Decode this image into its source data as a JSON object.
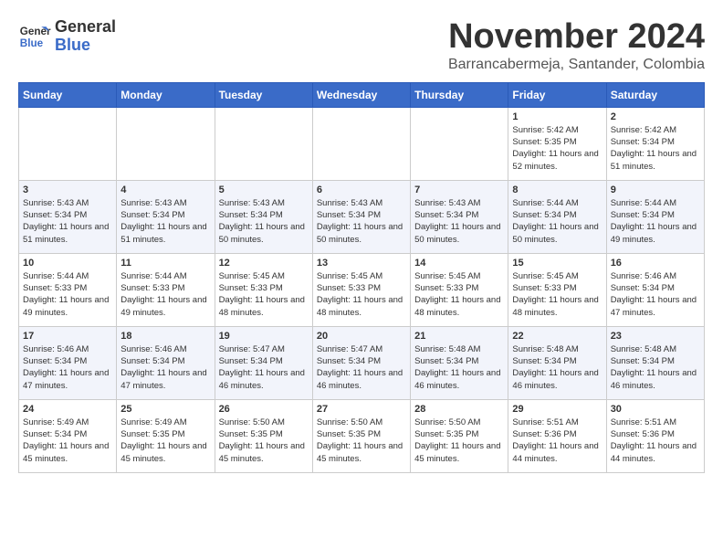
{
  "logo": {
    "line1": "General",
    "line2": "Blue"
  },
  "title": "November 2024",
  "subtitle": "Barrancabermeja, Santander, Colombia",
  "days_of_week": [
    "Sunday",
    "Monday",
    "Tuesday",
    "Wednesday",
    "Thursday",
    "Friday",
    "Saturday"
  ],
  "weeks": [
    [
      {
        "day": "",
        "info": ""
      },
      {
        "day": "",
        "info": ""
      },
      {
        "day": "",
        "info": ""
      },
      {
        "day": "",
        "info": ""
      },
      {
        "day": "",
        "info": ""
      },
      {
        "day": "1",
        "info": "Sunrise: 5:42 AM\nSunset: 5:35 PM\nDaylight: 11 hours and 52 minutes."
      },
      {
        "day": "2",
        "info": "Sunrise: 5:42 AM\nSunset: 5:34 PM\nDaylight: 11 hours and 51 minutes."
      }
    ],
    [
      {
        "day": "3",
        "info": "Sunrise: 5:43 AM\nSunset: 5:34 PM\nDaylight: 11 hours and 51 minutes."
      },
      {
        "day": "4",
        "info": "Sunrise: 5:43 AM\nSunset: 5:34 PM\nDaylight: 11 hours and 51 minutes."
      },
      {
        "day": "5",
        "info": "Sunrise: 5:43 AM\nSunset: 5:34 PM\nDaylight: 11 hours and 50 minutes."
      },
      {
        "day": "6",
        "info": "Sunrise: 5:43 AM\nSunset: 5:34 PM\nDaylight: 11 hours and 50 minutes."
      },
      {
        "day": "7",
        "info": "Sunrise: 5:43 AM\nSunset: 5:34 PM\nDaylight: 11 hours and 50 minutes."
      },
      {
        "day": "8",
        "info": "Sunrise: 5:44 AM\nSunset: 5:34 PM\nDaylight: 11 hours and 50 minutes."
      },
      {
        "day": "9",
        "info": "Sunrise: 5:44 AM\nSunset: 5:34 PM\nDaylight: 11 hours and 49 minutes."
      }
    ],
    [
      {
        "day": "10",
        "info": "Sunrise: 5:44 AM\nSunset: 5:33 PM\nDaylight: 11 hours and 49 minutes."
      },
      {
        "day": "11",
        "info": "Sunrise: 5:44 AM\nSunset: 5:33 PM\nDaylight: 11 hours and 49 minutes."
      },
      {
        "day": "12",
        "info": "Sunrise: 5:45 AM\nSunset: 5:33 PM\nDaylight: 11 hours and 48 minutes."
      },
      {
        "day": "13",
        "info": "Sunrise: 5:45 AM\nSunset: 5:33 PM\nDaylight: 11 hours and 48 minutes."
      },
      {
        "day": "14",
        "info": "Sunrise: 5:45 AM\nSunset: 5:33 PM\nDaylight: 11 hours and 48 minutes."
      },
      {
        "day": "15",
        "info": "Sunrise: 5:45 AM\nSunset: 5:33 PM\nDaylight: 11 hours and 48 minutes."
      },
      {
        "day": "16",
        "info": "Sunrise: 5:46 AM\nSunset: 5:34 PM\nDaylight: 11 hours and 47 minutes."
      }
    ],
    [
      {
        "day": "17",
        "info": "Sunrise: 5:46 AM\nSunset: 5:34 PM\nDaylight: 11 hours and 47 minutes."
      },
      {
        "day": "18",
        "info": "Sunrise: 5:46 AM\nSunset: 5:34 PM\nDaylight: 11 hours and 47 minutes."
      },
      {
        "day": "19",
        "info": "Sunrise: 5:47 AM\nSunset: 5:34 PM\nDaylight: 11 hours and 46 minutes."
      },
      {
        "day": "20",
        "info": "Sunrise: 5:47 AM\nSunset: 5:34 PM\nDaylight: 11 hours and 46 minutes."
      },
      {
        "day": "21",
        "info": "Sunrise: 5:48 AM\nSunset: 5:34 PM\nDaylight: 11 hours and 46 minutes."
      },
      {
        "day": "22",
        "info": "Sunrise: 5:48 AM\nSunset: 5:34 PM\nDaylight: 11 hours and 46 minutes."
      },
      {
        "day": "23",
        "info": "Sunrise: 5:48 AM\nSunset: 5:34 PM\nDaylight: 11 hours and 46 minutes."
      }
    ],
    [
      {
        "day": "24",
        "info": "Sunrise: 5:49 AM\nSunset: 5:34 PM\nDaylight: 11 hours and 45 minutes."
      },
      {
        "day": "25",
        "info": "Sunrise: 5:49 AM\nSunset: 5:35 PM\nDaylight: 11 hours and 45 minutes."
      },
      {
        "day": "26",
        "info": "Sunrise: 5:50 AM\nSunset: 5:35 PM\nDaylight: 11 hours and 45 minutes."
      },
      {
        "day": "27",
        "info": "Sunrise: 5:50 AM\nSunset: 5:35 PM\nDaylight: 11 hours and 45 minutes."
      },
      {
        "day": "28",
        "info": "Sunrise: 5:50 AM\nSunset: 5:35 PM\nDaylight: 11 hours and 45 minutes."
      },
      {
        "day": "29",
        "info": "Sunrise: 5:51 AM\nSunset: 5:36 PM\nDaylight: 11 hours and 44 minutes."
      },
      {
        "day": "30",
        "info": "Sunrise: 5:51 AM\nSunset: 5:36 PM\nDaylight: 11 hours and 44 minutes."
      }
    ]
  ]
}
